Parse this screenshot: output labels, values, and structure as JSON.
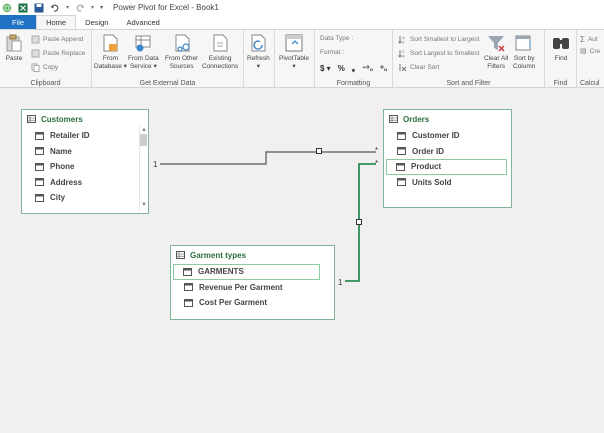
{
  "window": {
    "title": "Power Pivot for Excel - Book1",
    "dropdown_glyph": "▾"
  },
  "tabs": [
    {
      "label": "File"
    },
    {
      "label": "Home"
    },
    {
      "label": "Design"
    },
    {
      "label": "Advanced"
    }
  ],
  "ribbon": {
    "clipboard": {
      "label": "Clipboard",
      "paste": "Paste",
      "paste_append": "Paste Append",
      "paste_replace": "Paste Replace",
      "copy": "Copy"
    },
    "external": {
      "label": "Get External Data",
      "from_database": [
        "From",
        "Database ▾"
      ],
      "from_data_service": [
        "From Data",
        "Service ▾"
      ],
      "from_other": [
        "From Other",
        "Sources"
      ],
      "existing": [
        "Existing",
        "Connections"
      ]
    },
    "refresh": {
      "label": "Refresh",
      "arrow": "▾"
    },
    "pivot": {
      "label": "PivotTable",
      "arrow": "▾"
    },
    "formatting": {
      "label": "Formatting",
      "data_type": "Data Type :",
      "format": "Format :",
      "symbols": [
        "$ ▾",
        "%",
        "❟",
        "⁺⁰₀",
        "⁰₀"
      ]
    },
    "sort": {
      "label": "Sort and Filter",
      "asc": "Sort Smallest to Largest",
      "desc": "Sort Largest to Smallest",
      "clear_sort": "Clear Sort",
      "clear_filters": [
        "Clear All",
        "Filters"
      ],
      "sort_by_col": [
        "Sort by",
        "Column"
      ]
    },
    "find": {
      "label": "Find",
      "btn": "Find"
    },
    "calc": {
      "label": "Calcul",
      "auto": "Aut",
      "create": "Cre"
    }
  },
  "diagram": {
    "customers": {
      "title": "Customers",
      "fields": [
        "Retailer ID",
        "Name",
        "Phone",
        "Address",
        "City"
      ]
    },
    "orders": {
      "title": "Orders",
      "fields": [
        "Customer ID",
        "Order ID",
        "Product",
        "Units Sold"
      ]
    },
    "garments": {
      "title": "Garment types",
      "fields": [
        "GARMENTS",
        "Revenue Per Garment",
        "Cost Per Garment"
      ]
    },
    "labels": {
      "one_a": "1",
      "many_a": "*",
      "many_b": "*",
      "one_b": "1"
    },
    "colors": {
      "accent": "#2e8b57",
      "link": "#555555",
      "file_tab": "#2072c4"
    }
  }
}
